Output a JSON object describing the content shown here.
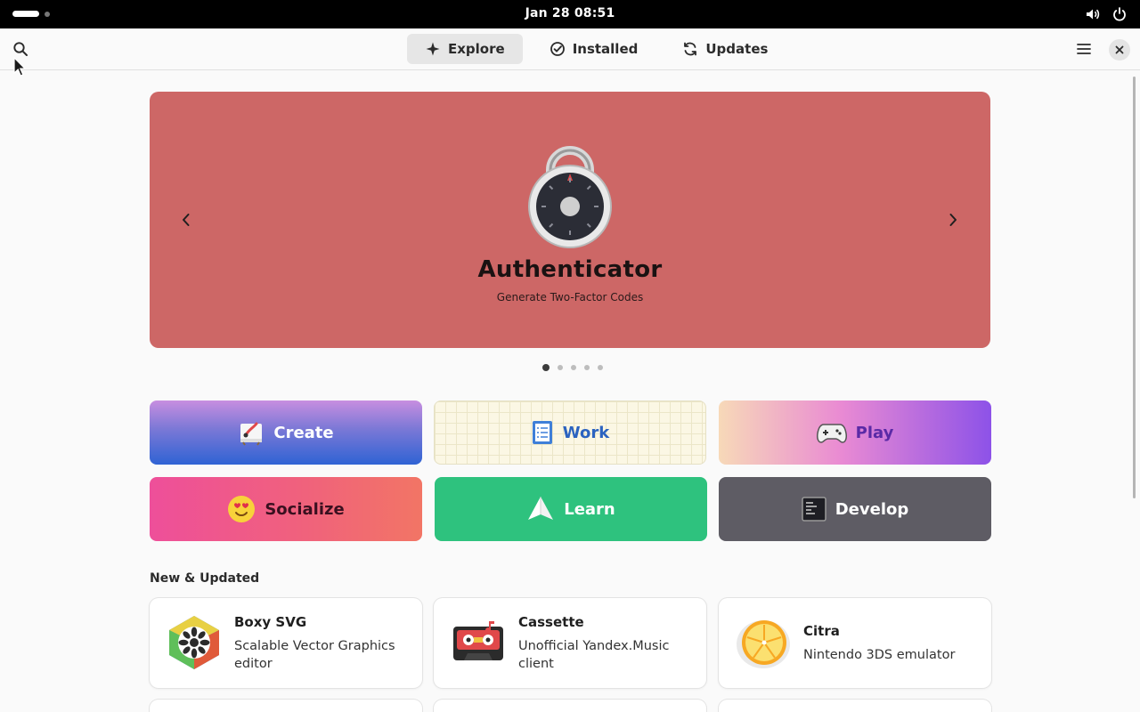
{
  "system_bar": {
    "clock": "Jan 28  08:51",
    "icons": [
      "activities-icon",
      "volume-icon",
      "power-icon"
    ]
  },
  "header": {
    "tabs": [
      {
        "label": "Explore",
        "icon": "explore-icon",
        "active": true
      },
      {
        "label": "Installed",
        "icon": "installed-check-icon",
        "active": false
      },
      {
        "label": "Updates",
        "icon": "updates-refresh-icon",
        "active": false
      }
    ],
    "icons": [
      "search-icon",
      "hamburger-menu-icon",
      "close-icon"
    ]
  },
  "banner": {
    "title": "Authenticator",
    "subtitle": "Generate Two-Factor Codes",
    "icon": "authenticator-lock-icon",
    "background": "#cd6766",
    "page_count": 5,
    "active_page": 1
  },
  "categories": [
    {
      "label": "Create",
      "icon": "create-icon"
    },
    {
      "label": "Work",
      "icon": "work-icon"
    },
    {
      "label": "Play",
      "icon": "gamepad-icon"
    },
    {
      "label": "Socialize",
      "icon": "heart-eyes-emoji-icon"
    },
    {
      "label": "Learn",
      "icon": "paper-plane-icon"
    },
    {
      "label": "Develop",
      "icon": "terminal-icon"
    }
  ],
  "new_updated": {
    "title": "New & Updated",
    "apps": [
      {
        "name": "Boxy SVG",
        "description": "Scalable Vector Graphics editor",
        "icon": "boxy-svg-icon"
      },
      {
        "name": "Cassette",
        "description": "Unofficial Yandex.Music client",
        "icon": "cassette-icon"
      },
      {
        "name": "Citra",
        "description": "Nintendo 3DS emulator",
        "icon": "citra-icon"
      }
    ]
  },
  "colors": {
    "accent": "#3584e4",
    "learn": "#2ec27e",
    "develop": "#5e5c64"
  }
}
